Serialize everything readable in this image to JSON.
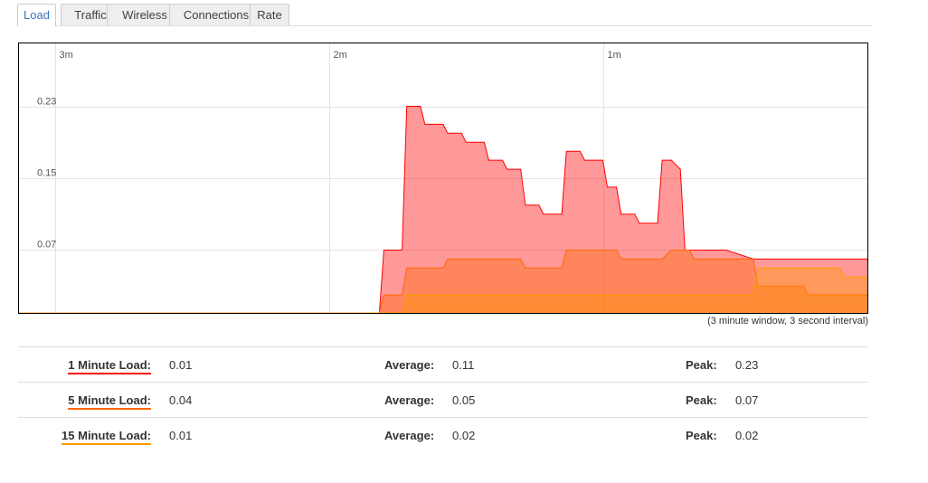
{
  "tabs": [
    {
      "label": "Load",
      "active": true
    },
    {
      "label": "Traffic",
      "active": false
    },
    {
      "label": "Wireless",
      "active": false
    },
    {
      "label": "Connections",
      "active": false
    },
    {
      "label": "Rate",
      "active": false
    }
  ],
  "graph": {
    "caption": "(3 minute window, 3 second interval)"
  },
  "stats": [
    {
      "label": "1 Minute Load:",
      "value": "0.01",
      "avg_label": "Average:",
      "avg": "0.11",
      "peak_label": "Peak:",
      "peak": "0.23",
      "color": "#ff0000"
    },
    {
      "label": "5 Minute Load:",
      "value": "0.04",
      "avg_label": "Average:",
      "avg": "0.05",
      "peak_label": "Peak:",
      "peak": "0.07",
      "color": "#ff6600"
    },
    {
      "label": "15 Minute Load:",
      "value": "0.01",
      "avg_label": "Average:",
      "avg": "0.02",
      "peak_label": "Peak:",
      "peak": "0.02",
      "color": "#ff9900"
    }
  ],
  "chart_data": {
    "type": "area",
    "x_tick_labels": [
      "3m",
      "2m",
      "1m"
    ],
    "y_tick_labels": [
      "0.23",
      "0.15",
      "0.07"
    ],
    "y_ticks": [
      0.23,
      0.15,
      0.07
    ],
    "ylim": [
      0,
      0.3
    ],
    "x_range_seconds": [
      0,
      186
    ],
    "x_tick_seconds": [
      8,
      68,
      128
    ],
    "colors": {
      "load1": "#ff0000",
      "load5": "#ff6600",
      "load15": "#ff9900"
    },
    "series": [
      {
        "name": "1 Minute Load",
        "key": "load1",
        "points": [
          [
            0,
            0
          ],
          [
            79,
            0
          ],
          [
            80,
            0.07
          ],
          [
            84,
            0.07
          ],
          [
            85,
            0.23
          ],
          [
            88,
            0.23
          ],
          [
            89,
            0.21
          ],
          [
            93,
            0.21
          ],
          [
            94,
            0.2
          ],
          [
            97,
            0.2
          ],
          [
            98,
            0.19
          ],
          [
            102,
            0.19
          ],
          [
            103,
            0.17
          ],
          [
            106,
            0.17
          ],
          [
            107,
            0.16
          ],
          [
            110,
            0.16
          ],
          [
            111,
            0.12
          ],
          [
            114,
            0.12
          ],
          [
            115,
            0.11
          ],
          [
            119,
            0.11
          ],
          [
            120,
            0.18
          ],
          [
            123,
            0.18
          ],
          [
            124,
            0.17
          ],
          [
            128,
            0.17
          ],
          [
            129,
            0.14
          ],
          [
            131,
            0.14
          ],
          [
            132,
            0.11
          ],
          [
            135,
            0.11
          ],
          [
            136,
            0.1
          ],
          [
            140,
            0.1
          ],
          [
            141,
            0.17
          ],
          [
            143,
            0.17
          ],
          [
            145,
            0.16
          ],
          [
            146,
            0.07
          ],
          [
            155,
            0.07
          ],
          [
            161,
            0.06
          ],
          [
            186,
            0.06
          ]
        ]
      },
      {
        "name": "5 Minute Load",
        "key": "load5",
        "points": [
          [
            0,
            0
          ],
          [
            79,
            0
          ],
          [
            80,
            0.02
          ],
          [
            84,
            0.02
          ],
          [
            85,
            0.05
          ],
          [
            93,
            0.05
          ],
          [
            94,
            0.06
          ],
          [
            110,
            0.06
          ],
          [
            111,
            0.05
          ],
          [
            119,
            0.05
          ],
          [
            120,
            0.07
          ],
          [
            131,
            0.07
          ],
          [
            132,
            0.06
          ],
          [
            141,
            0.06
          ],
          [
            143,
            0.07
          ],
          [
            147,
            0.07
          ],
          [
            148,
            0.06
          ],
          [
            161,
            0.06
          ],
          [
            162,
            0.03
          ],
          [
            172,
            0.03
          ],
          [
            173,
            0.02
          ],
          [
            186,
            0.02
          ]
        ]
      },
      {
        "name": "15 Minute Load",
        "key": "load15",
        "points": [
          [
            0,
            0
          ],
          [
            84,
            0
          ],
          [
            85,
            0.02
          ],
          [
            161,
            0.02
          ],
          [
            162,
            0.05
          ],
          [
            180,
            0.05
          ],
          [
            181,
            0.04
          ],
          [
            186,
            0.04
          ]
        ]
      }
    ]
  }
}
